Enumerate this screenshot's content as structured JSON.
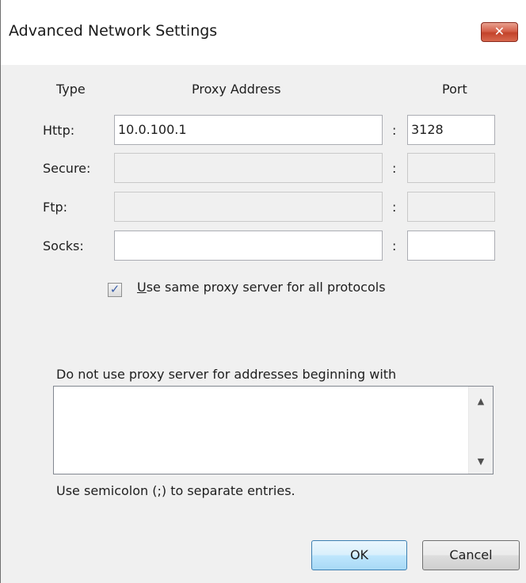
{
  "window": {
    "title": "Advanced Network Settings",
    "close_label": "✕"
  },
  "headers": {
    "type": "Type",
    "proxy_address": "Proxy Address",
    "port": "Port"
  },
  "rows": [
    {
      "label": "Http:",
      "address": "10.0.100.1",
      "port": "3128",
      "enabled": true
    },
    {
      "label": "Secure:",
      "address": "",
      "port": "",
      "enabled": false
    },
    {
      "label": "Ftp:",
      "address": "",
      "port": "",
      "enabled": false
    },
    {
      "label": "Socks:",
      "address": "",
      "port": "",
      "enabled": true
    }
  ],
  "separator": ":",
  "same_proxy": {
    "checked": true,
    "mnemonic": "U",
    "label_rest": "se same proxy server for all protocols"
  },
  "no_proxy": {
    "label": "Do not use proxy server for addresses beginning with",
    "value": "",
    "hint": "Use semicolon (;) to separate entries."
  },
  "buttons": {
    "ok": "OK",
    "cancel": "Cancel"
  },
  "icons": {
    "close": "close-icon",
    "check": "checkmark-icon",
    "scroll_up": "scroll-up-arrow-icon",
    "scroll_down": "scroll-down-arrow-icon"
  }
}
